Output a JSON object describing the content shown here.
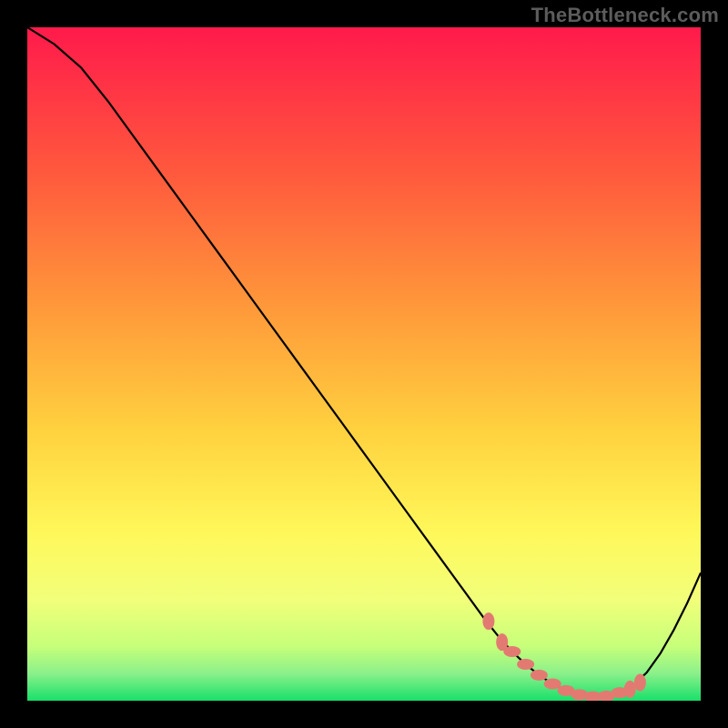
{
  "watermark": "TheBottleneck.com",
  "colors": {
    "black": "#000000",
    "curve": "#000000",
    "dot_fill": "#e37a72",
    "grad_top": "#ff1a4b",
    "grad_mid1": "#ff6a3d",
    "grad_mid2": "#ffd23f",
    "grad_mid3": "#f8ff5a",
    "grad_mid4": "#d8ff7a",
    "grad_bottom": "#18e06a"
  },
  "chart_data": {
    "type": "line",
    "title": "",
    "xlabel": "",
    "ylabel": "",
    "xlim": [
      0,
      100
    ],
    "ylim": [
      0,
      100
    ],
    "grid": false,
    "series": [
      {
        "name": "bottleneck-curve",
        "x": [
          0,
          4,
          8,
          12,
          16,
          20,
          24,
          28,
          32,
          36,
          40,
          44,
          48,
          52,
          56,
          60,
          64,
          68,
          70,
          72,
          74,
          76,
          78,
          80,
          82,
          84,
          86,
          88,
          90,
          92,
          94,
          96,
          98,
          100
        ],
        "y": [
          100,
          97.5,
          94,
          89,
          83.5,
          78,
          72.5,
          67,
          61.5,
          56,
          50.5,
          45,
          39.5,
          34,
          28.5,
          23,
          17.5,
          12,
          9.5,
          7.3,
          5.4,
          3.8,
          2.5,
          1.5,
          0.9,
          0.6,
          0.7,
          1.2,
          2.3,
          4.2,
          7.0,
          10.5,
          14.5,
          19
        ]
      }
    ],
    "highlight_points": {
      "name": "optimal-range-dots",
      "x": [
        68.5,
        70.5,
        72.0,
        74.0,
        76.0,
        78.0,
        80.0,
        82.0,
        84.0,
        86.0,
        88.0,
        89.5,
        91.0
      ],
      "y": [
        11.8,
        8.7,
        7.3,
        5.4,
        3.8,
        2.5,
        1.5,
        0.9,
        0.6,
        0.7,
        1.2,
        1.7,
        2.7
      ]
    }
  }
}
